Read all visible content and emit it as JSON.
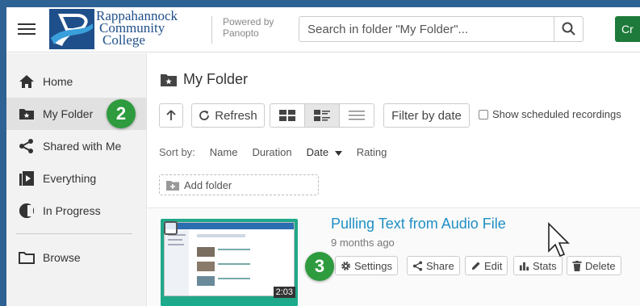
{
  "header": {
    "logo_line1": "Rappahannock",
    "logo_line2": "Community",
    "logo_line3": "College",
    "powered_line1": "Powered by",
    "powered_line2": "Panopto",
    "search_placeholder": "Search in folder \"My Folder\"...",
    "create_label": "Cr"
  },
  "sidebar": {
    "items": [
      {
        "label": "Home",
        "icon": "home-icon"
      },
      {
        "label": "My Folder",
        "icon": "folder-star-icon",
        "active": true
      },
      {
        "label": "Shared with Me",
        "icon": "share-icon"
      },
      {
        "label": "Everything",
        "icon": "play-library-icon"
      },
      {
        "label": "In Progress",
        "icon": "in-progress-icon"
      },
      {
        "label": "Browse",
        "icon": "folder-icon"
      }
    ]
  },
  "badges": {
    "step2": "2",
    "step3": "3"
  },
  "main": {
    "folder_title": "My Folder",
    "refresh_label": "Refresh",
    "filter_label": "Filter by date",
    "scheduled_label": "Show scheduled recordings",
    "sort_by_label": "Sort by:",
    "sort_options": [
      "Name",
      "Duration",
      "Date",
      "Rating"
    ],
    "active_sort": "Date",
    "add_folder_label": "Add folder",
    "session": {
      "title": "Pulling Text from Audio File",
      "age": "9 months ago",
      "duration": "2:03",
      "actions": [
        "Settings",
        "Share",
        "Edit",
        "Stats",
        "Delete"
      ]
    }
  },
  "colors": {
    "frame_border": "#2e6295",
    "brand_blue": "#1f4f8a",
    "badge_green": "#2e9b3e",
    "link_blue": "#1e8fc4",
    "create_green": "#1e7a3a"
  }
}
